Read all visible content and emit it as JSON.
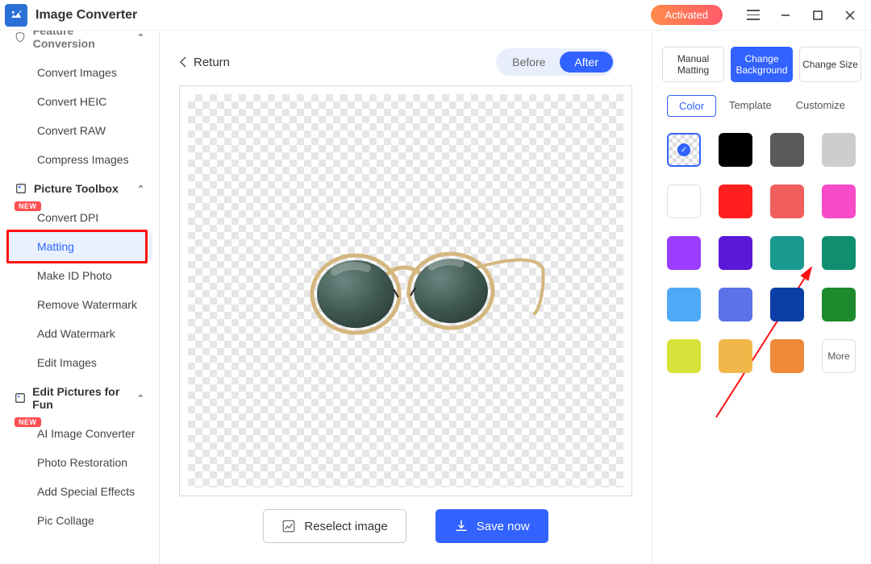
{
  "app": {
    "title": "Image Converter"
  },
  "titlebar": {
    "activated": "Activated"
  },
  "sidebar": {
    "section_feature": "Feature Conversion",
    "section_toolbox": "Picture Toolbox",
    "section_fun": "Edit Pictures for Fun",
    "new_badge": "NEW",
    "items_feature": [
      "Convert Images",
      "Convert HEIC",
      "Convert RAW",
      "Compress Images"
    ],
    "items_toolbox": [
      "Convert DPI",
      "Matting",
      "Make ID Photo",
      "Remove Watermark",
      "Add Watermark",
      "Edit Images"
    ],
    "items_fun": [
      "AI Image Converter",
      "Photo Restoration",
      "Add Special Effects",
      "Pic Collage"
    ]
  },
  "main": {
    "return": "Return",
    "toggle_before": "Before",
    "toggle_after": "After",
    "reselect": "Reselect image",
    "save": "Save now"
  },
  "panel": {
    "manual": "Manual Matting",
    "change_bg": "Change Background",
    "change_size": "Change Size",
    "sub_color": "Color",
    "sub_template": "Template",
    "sub_custom": "Customize",
    "more": "More",
    "colors": [
      "#000000",
      "#5a5a5a",
      "#cdcdcd",
      "#ffffff",
      "#ff1f1f",
      "#f05e5e",
      "#f84bc9",
      "#9a3dff",
      "#5c18d6",
      "#1a9a8f",
      "#0f8f70",
      "#4ea9f7",
      "#5a73e8",
      "#0c3ea8",
      "#1d8a2d",
      "#d6e33a",
      "#f0b84a",
      "#ee8a3a"
    ]
  }
}
